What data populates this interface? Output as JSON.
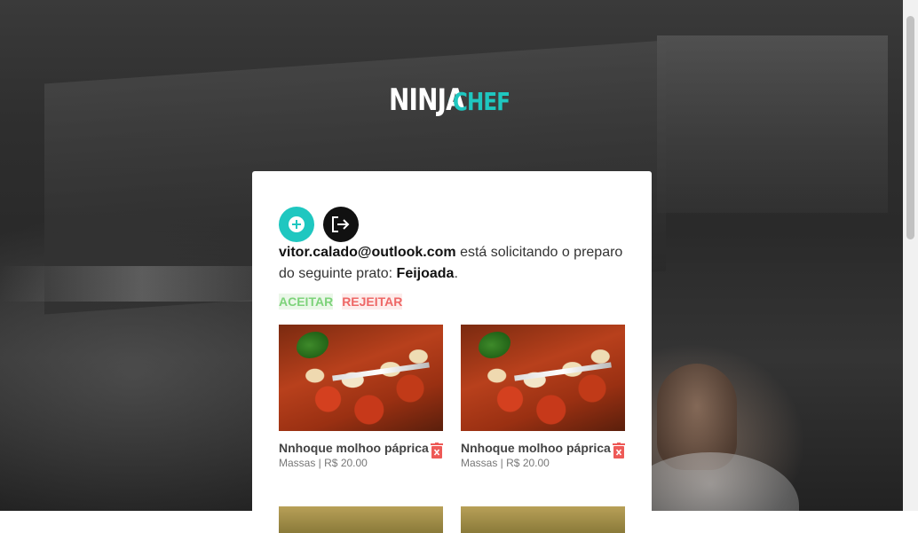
{
  "brand": {
    "logo_part1": "NINJA",
    "logo_part2": "CHEF",
    "accent_color": "#1fc7c0"
  },
  "actions": {
    "add_icon": "plus-circle-icon",
    "logout_icon": "logout-icon"
  },
  "request": {
    "user_email": "vitor.calado@outlook.com",
    "text_middle": " está solicitando o preparo do seguinte prato: ",
    "dish_name": "Feijoada",
    "text_end": ".",
    "accept_label": "ACEITAR",
    "reject_label": "REJEITAR",
    "accept_color": "#7dd37a",
    "reject_color": "#ee6766"
  },
  "dishes": [
    {
      "name": "Nnhoque molhoo páprica",
      "category": "Massas",
      "separator": " | ",
      "price": "R$ 20.00",
      "delete_icon": "trash-icon"
    },
    {
      "name": "Nnhoque molhoo páprica",
      "category": "Massas",
      "separator": " | ",
      "price": "R$ 20.00",
      "delete_icon": "trash-icon"
    }
  ]
}
